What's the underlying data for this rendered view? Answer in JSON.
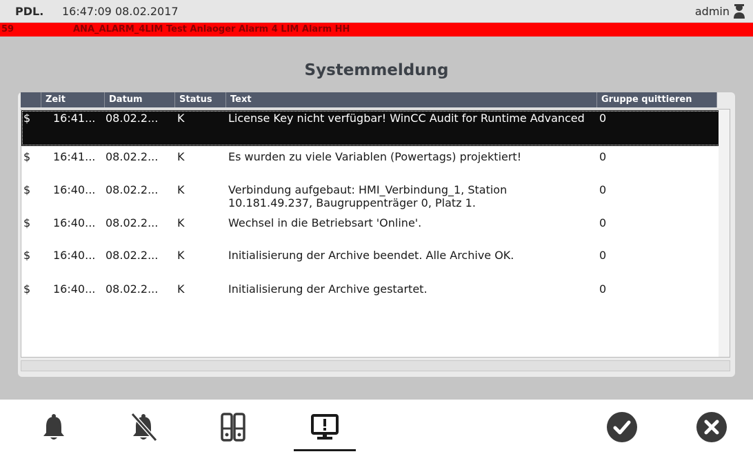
{
  "header": {
    "logo": "PDL.",
    "clock": "16:47:09 08.02.2017",
    "user": "admin",
    "user_icon": "user-icon"
  },
  "alarm_bar": {
    "number": "59",
    "message": "ANA_ALARM_4LIM Test Anlaoger Alarm 4 LIM Alarm HH"
  },
  "page": {
    "title": "Systemmeldung"
  },
  "table": {
    "columns": [
      {
        "key": "zeit",
        "label": "Zeit"
      },
      {
        "key": "datum",
        "label": "Datum"
      },
      {
        "key": "status",
        "label": "Status"
      },
      {
        "key": "text",
        "label": "Text"
      },
      {
        "key": "gruppe",
        "label": "Gruppe quittieren"
      }
    ],
    "rows": [
      {
        "icon": "$",
        "zeit": "16:41...",
        "datum": "08.02.2...",
        "status": "K",
        "text": "License Key nicht verfügbar! WinCC Audit for Runtime Advanced",
        "gruppe": "0"
      },
      {
        "icon": "$",
        "zeit": "16:41...",
        "datum": "08.02.2...",
        "status": "K",
        "text": "Es wurden zu viele Variablen (Powertags) projektiert!",
        "gruppe": "0"
      },
      {
        "icon": "$",
        "zeit": "16:40...",
        "datum": "08.02.2...",
        "status": "K",
        "text": "Verbindung aufgebaut: HMI_Verbindung_1, Station 10.181.49.237, Baugruppenträger 0, Platz 1.",
        "gruppe": "0"
      },
      {
        "icon": "$",
        "zeit": "16:40...",
        "datum": "08.02.2...",
        "status": "K",
        "text": "Wechsel in die Betriebsart 'Online'.",
        "gruppe": "0"
      },
      {
        "icon": "$",
        "zeit": "16:40...",
        "datum": "08.02.2...",
        "status": "K",
        "text": "Initialisierung der Archive beendet. Alle Archive OK.",
        "gruppe": "0"
      },
      {
        "icon": "$",
        "zeit": "16:40...",
        "datum": "08.02.2...",
        "status": "K",
        "text": "Initialisierung der Archive gestartet.",
        "gruppe": "0"
      }
    ]
  },
  "toolbar": {
    "buttons": [
      {
        "name": "alarm-bell-button",
        "icon": "bell-icon"
      },
      {
        "name": "alarm-mute-button",
        "icon": "bell-off-icon"
      },
      {
        "name": "archive-button",
        "icon": "binders-icon"
      },
      {
        "name": "system-message-button",
        "icon": "monitor-alert-icon",
        "active": true
      },
      {
        "name": "acknowledge-button",
        "icon": "check-circle-icon"
      },
      {
        "name": "cancel-button",
        "icon": "close-circle-icon"
      }
    ]
  },
  "colors": {
    "alarm_bar": "#ff0000",
    "header_bg": "#e6e6e6",
    "panel_bg": "#c5c5c5",
    "table_header": "#525a6b",
    "selected_row": "#0d0d0d",
    "icon": "#3a3a3a"
  }
}
